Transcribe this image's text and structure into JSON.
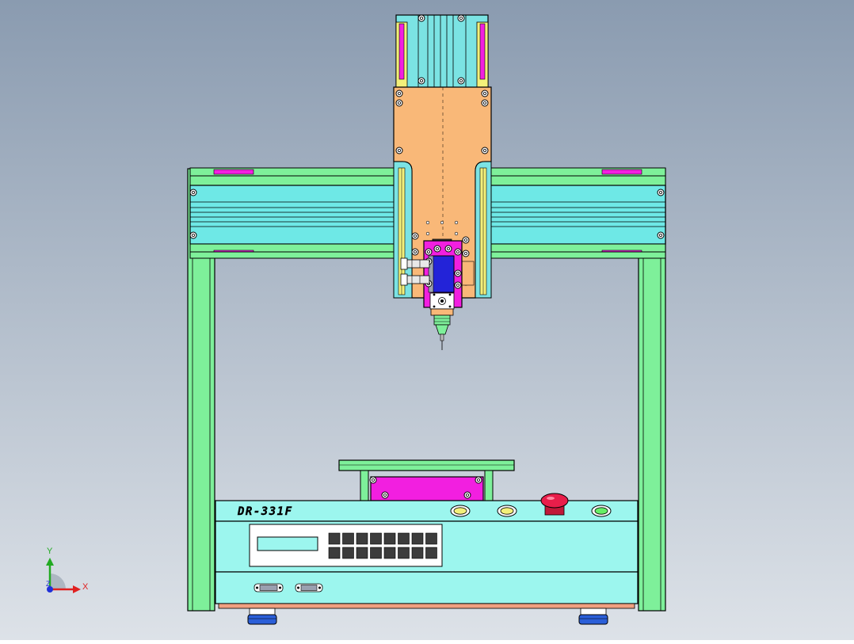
{
  "model_label": "DR-331F",
  "triad": {
    "x_label": "X",
    "y_label": "Y",
    "z_label": "Z"
  },
  "colors": {
    "background_top": "#8a9bb0",
    "background_bottom": "#dde2e8",
    "frame_green": "#7ef09a",
    "beam_cyan": "#6ee8e6",
    "carriage_orange": "#f9b878",
    "rail_cyan": "#7be3e3",
    "rail_yellow": "#f3f07a",
    "head_magenta": "#f21fe0",
    "head_blue": "#2323d8",
    "stop_red": "#e81e4a",
    "button_yellow": "#f3f07a",
    "button_green": "#66ef66",
    "keypad_dark": "#3c3c3c",
    "feet_blue": "#2b5fd8"
  },
  "panel": {
    "button_count": 4,
    "keypad_rows": 2,
    "keypad_cols": 8
  }
}
